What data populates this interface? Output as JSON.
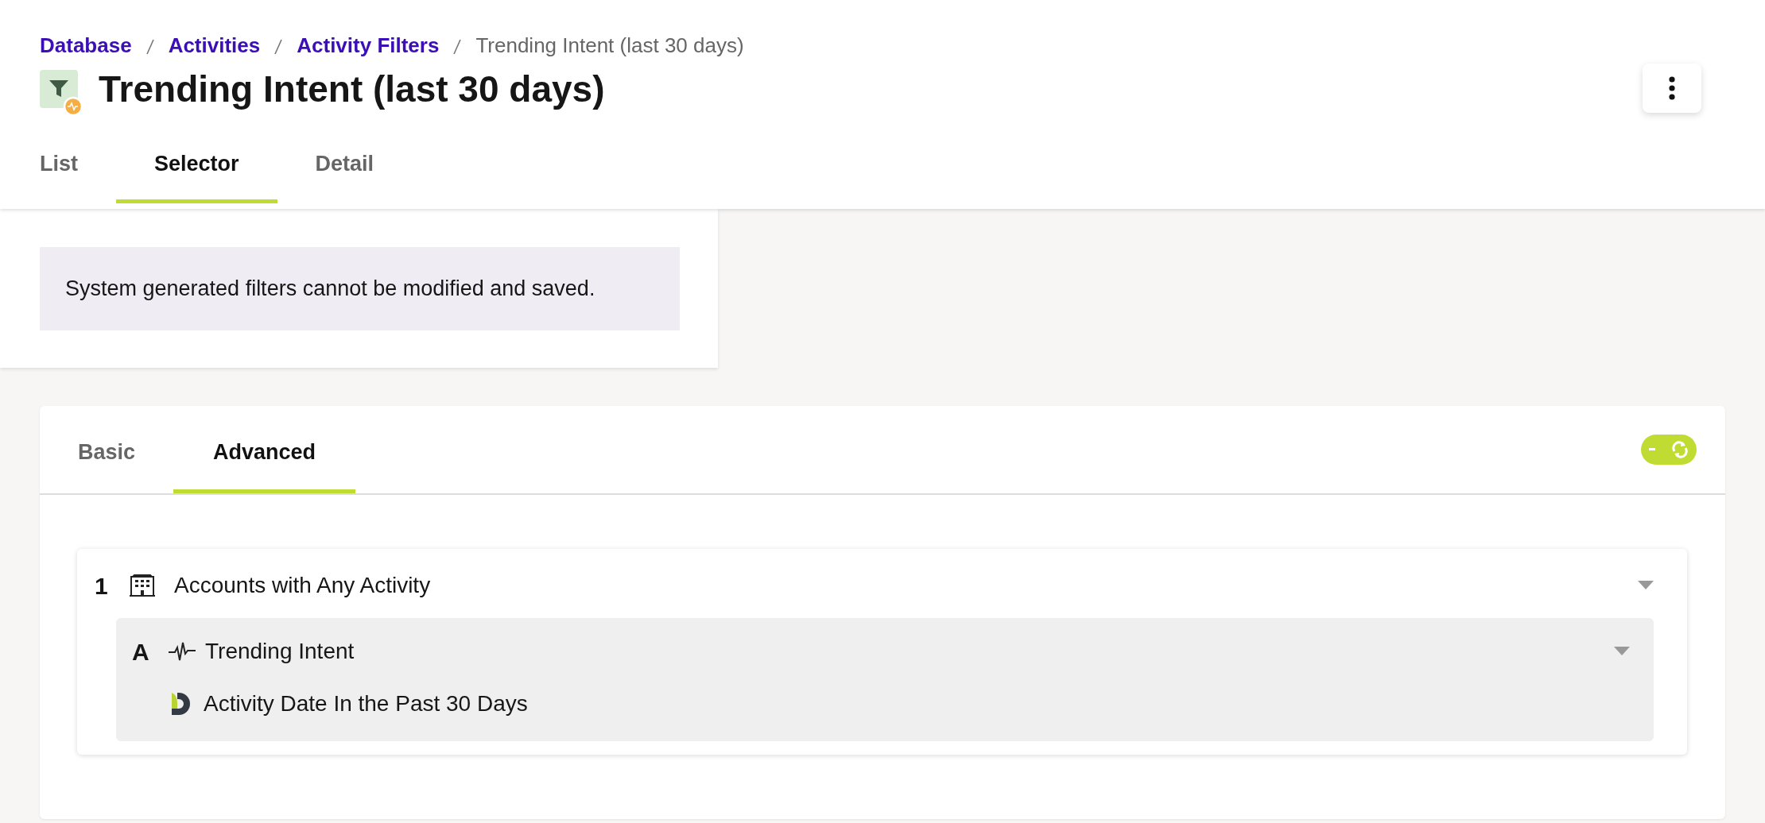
{
  "breadcrumbs": [
    {
      "label": "Database",
      "kind": "link"
    },
    {
      "label": "Activities",
      "kind": "link"
    },
    {
      "label": "Activity Filters",
      "kind": "link"
    },
    {
      "label": "Trending Intent (last 30 days)",
      "kind": "current"
    }
  ],
  "title": "Trending Intent (last 30 days)",
  "tabs": [
    {
      "label": "List",
      "selected": false
    },
    {
      "label": "Selector",
      "selected": true
    },
    {
      "label": "Detail",
      "selected": false
    }
  ],
  "notice": "System generated filters cannot be modified and saved.",
  "filter_tabs": [
    {
      "label": "Basic",
      "selected": false
    },
    {
      "label": "Advanced",
      "selected": true
    }
  ],
  "auto_refresh": {
    "on": true
  },
  "groups": [
    {
      "number": "1",
      "label": "Accounts with Any Activity",
      "conditions": [
        {
          "letter": "A",
          "label": "Trending Intent",
          "items": [
            {
              "label": "Activity Date In the Past 30 Days"
            }
          ]
        }
      ]
    }
  ]
}
